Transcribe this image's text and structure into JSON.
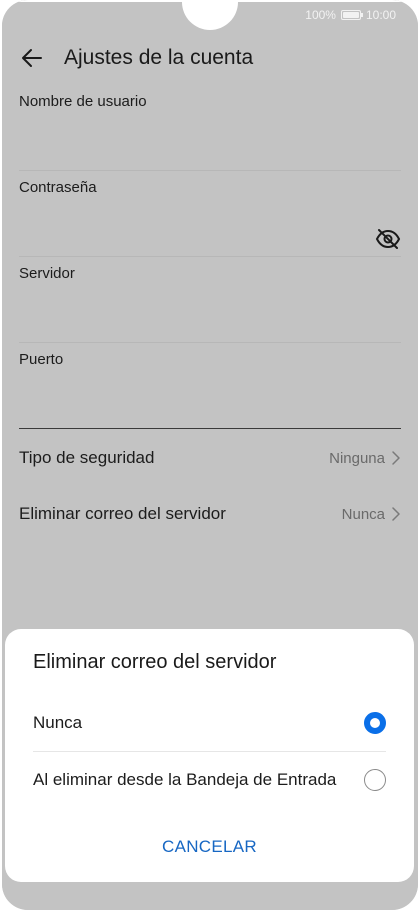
{
  "status_bar": {
    "battery": "100%",
    "time": "10:00"
  },
  "app_bar": {
    "back_icon": "arrow-left-icon",
    "title": "Ajustes de la cuenta"
  },
  "fields": {
    "username": {
      "label": "Nombre de usuario",
      "value": ""
    },
    "password": {
      "label": "Contraseña",
      "value": "",
      "icon": "eye-off-icon"
    },
    "server": {
      "label": "Servidor",
      "value": ""
    },
    "port": {
      "label": "Puerto",
      "value": ""
    }
  },
  "settings": {
    "security_type": {
      "label": "Tipo de seguridad",
      "value": "Ninguna"
    },
    "delete_from_server": {
      "label": "Eliminar correo del servidor",
      "value": "Nunca"
    }
  },
  "dialog": {
    "title": "Eliminar correo del servidor",
    "options": [
      {
        "label": "Nunca",
        "selected": true
      },
      {
        "label": "Al eliminar desde la Bandeja de Entrada",
        "selected": false
      }
    ],
    "cancel_label": "CANCELAR"
  },
  "colors": {
    "accent": "#0a6fe8",
    "link": "#1767c3",
    "overlay": "#c3c3c3"
  }
}
